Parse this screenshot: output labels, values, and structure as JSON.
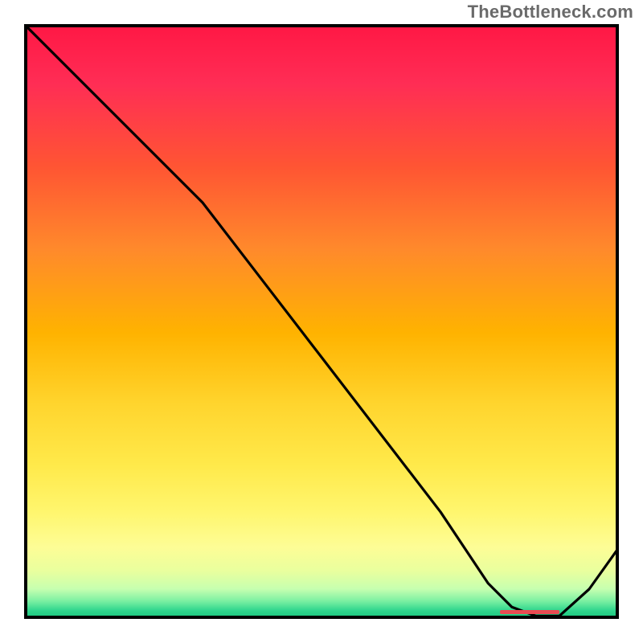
{
  "watermark": "TheBottleneck.com",
  "chart_data": {
    "type": "line",
    "title": "",
    "xlabel": "",
    "ylabel": "",
    "xlim": [
      0,
      100
    ],
    "ylim": [
      0,
      100
    ],
    "x": [
      0,
      10,
      20,
      25,
      30,
      40,
      50,
      60,
      70,
      78,
      82,
      86,
      90,
      95,
      100
    ],
    "values": [
      100,
      90,
      80,
      75,
      70,
      57,
      44,
      31,
      18,
      6,
      2,
      0.5,
      0.5,
      5,
      12
    ],
    "annotation": {
      "type": "optimum-range-marker",
      "x_start": 80,
      "x_end": 90,
      "y": 0.5,
      "color": "#e94b52"
    },
    "background": "vertical-gradient-red-to-green"
  }
}
